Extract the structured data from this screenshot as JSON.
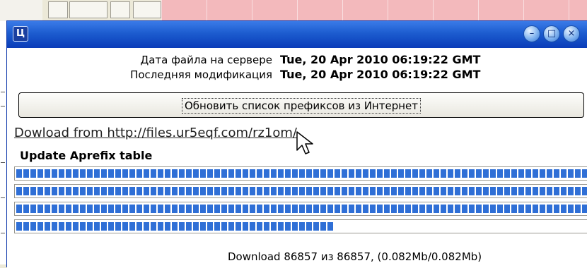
{
  "dialog": {
    "app_icon": "app-logo-icon",
    "title_buttons": [
      "minimize-icon",
      "restore-icon",
      "close-icon"
    ],
    "server_date": {
      "label": "Дата файла на сервере",
      "value": "Tue, 20 Apr 2010 06:19:22 GMT"
    },
    "last_modified": {
      "label": "Последняя модификация",
      "value": "Tue, 20 Apr 2010 06:19:22 GMT"
    },
    "update_button": "Обновить список префиксов из Интернет",
    "download_link": "Dowload from http://files.ur5eqf.com/rz1om/",
    "section_title": "Update Aprefix table",
    "progress": [
      1.0,
      1.0,
      1.0,
      0.56
    ],
    "status": "Download 86857 из 86857, (0.082Mb/0.082Mb)"
  },
  "colors": {
    "titlebar": "#1c5ccf",
    "progress": "#2f6fd6",
    "background_tab": "#f3b9bc"
  }
}
